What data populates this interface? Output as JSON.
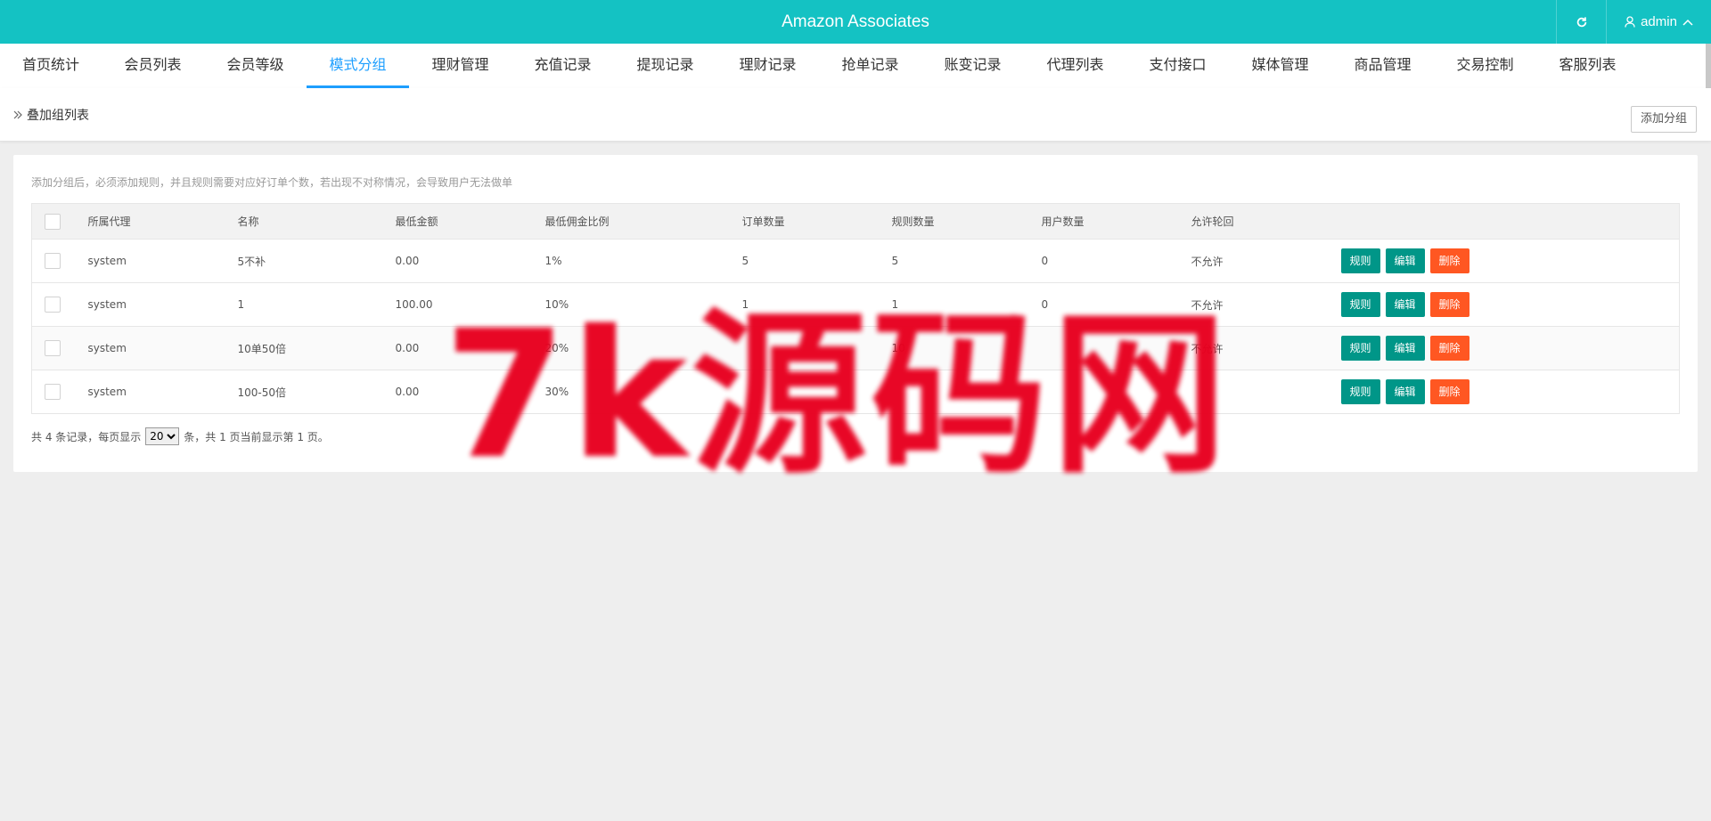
{
  "header": {
    "title": "Amazon Associates",
    "user": "admin"
  },
  "nav": {
    "tabs": [
      {
        "label": "首页统计"
      },
      {
        "label": "会员列表"
      },
      {
        "label": "会员等级"
      },
      {
        "label": "模式分组",
        "active": true
      },
      {
        "label": "理财管理"
      },
      {
        "label": "充值记录"
      },
      {
        "label": "提现记录"
      },
      {
        "label": "理财记录"
      },
      {
        "label": "抢单记录"
      },
      {
        "label": "账变记录"
      },
      {
        "label": "代理列表"
      },
      {
        "label": "支付接口"
      },
      {
        "label": "媒体管理"
      },
      {
        "label": "商品管理"
      },
      {
        "label": "交易控制"
      },
      {
        "label": "客服列表"
      }
    ]
  },
  "breadcrumb": {
    "label": "叠加组列表",
    "add_button": "添加分组"
  },
  "content": {
    "tip": "添加分组后，必须添加规则，并且规则需要对应好订单个数，若出现不对称情况，会导致用户无法做单",
    "table": {
      "columns": [
        "所属代理",
        "名称",
        "最低金额",
        "最低佣金比例",
        "订单数量",
        "规则数量",
        "用户数量",
        "允许轮回"
      ],
      "rows": [
        {
          "agent": "system",
          "name": "5不补",
          "min_amount": "0.00",
          "min_rate": "1%",
          "orders": "5",
          "rules": "5",
          "users": "0",
          "cycle": "不允许"
        },
        {
          "agent": "system",
          "name": "1",
          "min_amount": "100.00",
          "min_rate": "10%",
          "orders": "1",
          "rules": "1",
          "users": "0",
          "cycle": "不允许"
        },
        {
          "agent": "system",
          "name": "10单50倍",
          "min_amount": "0.00",
          "min_rate": "20%",
          "orders": "",
          "rules": "10",
          "users": "",
          "cycle": "不允许"
        },
        {
          "agent": "system",
          "name": "100-50倍",
          "min_amount": "0.00",
          "min_rate": "30%",
          "orders": "",
          "rules": "",
          "users": "",
          "cycle": ""
        }
      ],
      "actions": {
        "rule": "规则",
        "edit": "编辑",
        "delete": "删除"
      }
    },
    "pager": {
      "prefix": "共 4 条记录，每页显示",
      "page_size": "20",
      "suffix": "条，共 1 页当前显示第 1 页。"
    }
  },
  "watermark": "7k源码网",
  "colors": {
    "header": "#14c2c3",
    "active_tab": "#1e9fff",
    "btn_primary": "#009688",
    "btn_danger": "#ff5722"
  }
}
